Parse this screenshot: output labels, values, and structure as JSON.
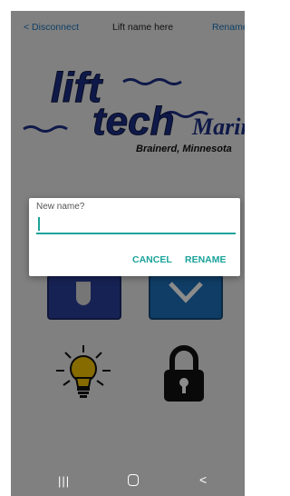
{
  "topbar": {
    "disconnect_label": "< Disconnect",
    "title": "Lift name here",
    "rename_label": "Rename"
  },
  "logo": {
    "line1": "lift",
    "line2": "tech",
    "line3": "Marine",
    "location": "Brainerd, Minnesota"
  },
  "dialog": {
    "label": "New name?",
    "input_value": "",
    "cancel_label": "CANCEL",
    "rename_label": "RENAME"
  },
  "controls": {
    "icons": [
      "light-bulb-icon",
      "lock-icon"
    ]
  },
  "navbar": {
    "recent_icon": "|||",
    "back_icon": "<"
  },
  "colors": {
    "accent": "#1aa39a",
    "link": "#1a73b8",
    "logo_blue": "#1c2f86"
  }
}
